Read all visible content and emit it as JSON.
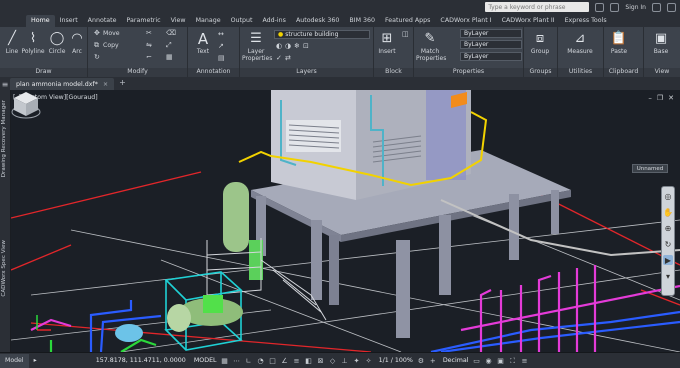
{
  "titlebar": {
    "search_placeholder": "Type a keyword or phrase",
    "signin": "Sign In"
  },
  "app_button": "A",
  "ribbon_tabs": [
    "Home",
    "Insert",
    "Annotate",
    "Parametric",
    "View",
    "Manage",
    "Output",
    "Add-ins",
    "Autodesk 360",
    "BIM 360",
    "Featured Apps",
    "CADWorx Plant I",
    "CADWorx Plant II",
    "Express Tools"
  ],
  "active_tab": "Home",
  "draw": {
    "line": "Line",
    "polyline": "Polyline",
    "circle": "Circle",
    "arc": "Arc",
    "label": "Draw"
  },
  "modify": {
    "move": "Move",
    "copy": "Copy",
    "label": "Modify"
  },
  "annotation": {
    "text": "Text",
    "label": "Annotation"
  },
  "layers": {
    "layer_properties": "Layer Properties",
    "current_layer": "structure building",
    "label": "Layers"
  },
  "block": {
    "insert": "Insert",
    "label": "Block"
  },
  "properties": {
    "match": "Match Properties",
    "bylayer_1": "ByLayer",
    "bylayer_2": "ByLayer",
    "bylayer_3": "ByLayer",
    "label": "Properties"
  },
  "groups": {
    "group": "Group",
    "label": "Groups"
  },
  "utilities": {
    "measure": "Measure",
    "label": "Utilities"
  },
  "clipboard": {
    "paste": "Paste",
    "label": "Clipboard"
  },
  "view": {
    "base": "Base",
    "label": "View"
  },
  "file_tab": {
    "name": "plan ammonia model.dxf*",
    "close": "×",
    "plus": "+"
  },
  "side_palettes": {
    "drawing_recovery": "Drawing Recovery Manager",
    "cadworx": "CADWorx Spec View"
  },
  "viewport": {
    "label": "[–][Custom View][Gouraud]",
    "unnamed": "Unnamed"
  },
  "statusbar": {
    "layout_tab": "Model",
    "coords": "157.8178, 111.4711, 0.0000",
    "model": "MODEL",
    "scale": "1/1 / 100%",
    "units": "Decimal"
  },
  "colors": {
    "accent_red": "#c73a3a",
    "pipe_yellow": "#f2d200",
    "pipe_magenta": "#e43bd8",
    "pipe_blue": "#2a5cff",
    "pipe_green": "#2bd83b",
    "boundary_red": "#e2262a",
    "structure_gray": "#a6aab9"
  }
}
